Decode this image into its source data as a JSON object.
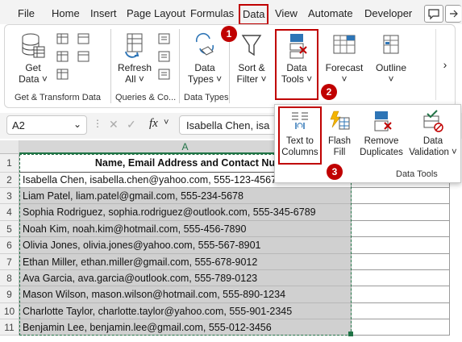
{
  "tabs": [
    "File",
    "Home",
    "Insert",
    "Page Layout",
    "Formulas",
    "Data",
    "View",
    "Automate",
    "Developer"
  ],
  "ribbon": {
    "get_data": {
      "line1": "Get",
      "line2": "Data ˅"
    },
    "refresh_all": {
      "line1": "Refresh",
      "line2": "All ˅"
    },
    "data_types": {
      "line1": "Data",
      "line2": "Types ˅"
    },
    "sort_filter": {
      "line1": "Sort &",
      "line2": "Filter ˅"
    },
    "data_tools": {
      "line1": "Data",
      "line2": "Tools ˅"
    },
    "forecast": {
      "line1": "Forecast",
      "line2": "˅"
    },
    "outline": {
      "line1": "Outline",
      "line2": "˅"
    },
    "more": "›",
    "groups": {
      "get_transform": "Get & Transform Data",
      "queries": "Queries & Co...",
      "data_types": "Data Types"
    }
  },
  "panel": {
    "text_to_columns": {
      "line1": "Text to",
      "line2": "Columns"
    },
    "flash_fill": {
      "line1": "Flash",
      "line2": "Fill"
    },
    "remove_duplicates": {
      "line1": "Remove",
      "line2": "Duplicates"
    },
    "data_validation": {
      "line1": "Data",
      "line2": "Validation ˅"
    },
    "group_label": "Data Tools"
  },
  "formula_bar": {
    "name_box": "A2",
    "formula": "Isabella Chen, isa",
    "fx": "fx",
    "cancel": "✕",
    "enter": "✓",
    "more": "⋮"
  },
  "sheet": {
    "col_a": "A",
    "header": "Name, Email Address and Contact Nu",
    "row_numbers": [
      "1",
      "2",
      "3",
      "4",
      "5",
      "6",
      "7",
      "8",
      "9",
      "10",
      "11"
    ],
    "rows": [
      "Isabella Chen, isabella.chen@yahoo.com, 555-123-4567",
      "Liam Patel, liam.patel@gmail.com, 555-234-5678",
      "Sophia Rodriguez, sophia.rodriguez@outlook.com, 555-345-6789",
      "Noah Kim, noah.kim@hotmail.com, 555-456-7890",
      "Olivia Jones, olivia.jones@yahoo.com, 555-567-8901",
      "Ethan Miller, ethan.miller@gmail.com, 555-678-9012",
      "Ava Garcia, ava.garcia@outlook.com, 555-789-0123",
      "Mason Wilson, mason.wilson@hotmail.com, 555-890-1234",
      "Charlotte Taylor, charlotte.taylor@yahoo.com, 555-901-2345",
      "Benjamin Lee, benjamin.lee@gmail.com, 555-012-3456"
    ]
  },
  "badges": [
    "1",
    "2",
    "3"
  ],
  "colors": {
    "accent": "#217346",
    "highlight": "#c00000",
    "selection": "#d0d0d0"
  }
}
